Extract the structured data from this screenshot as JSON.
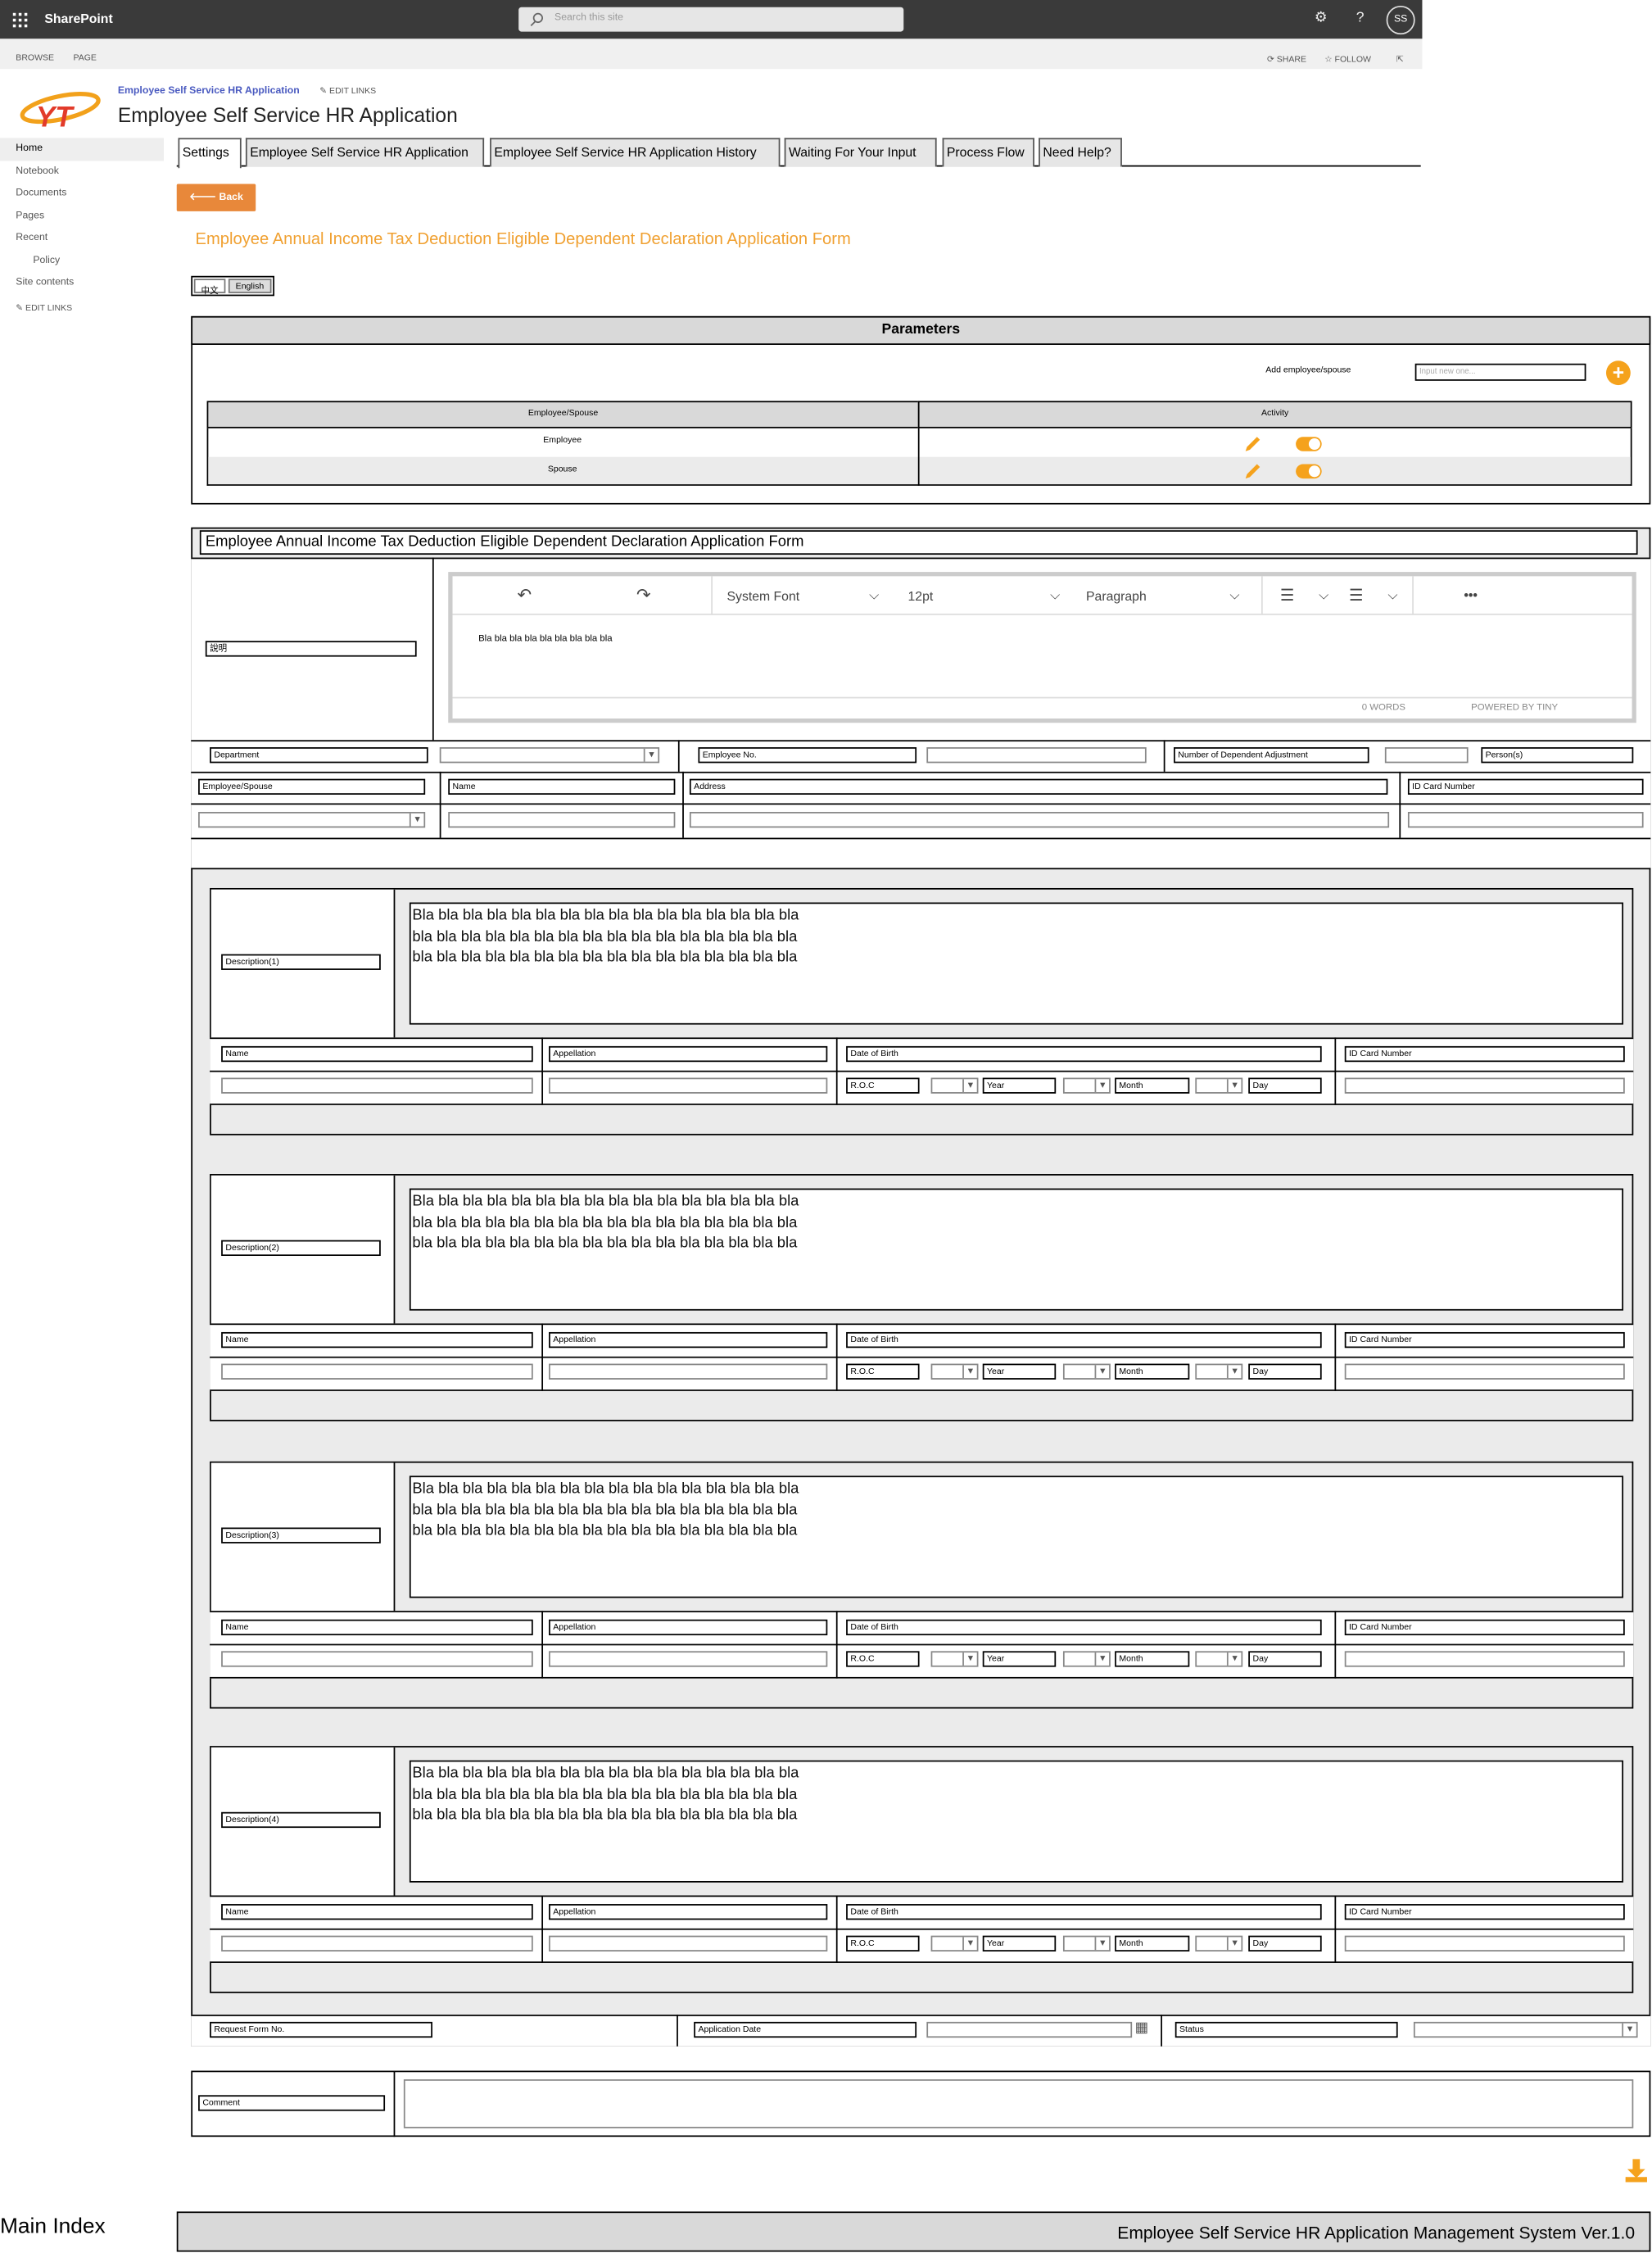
{
  "topbar": {
    "app_name": "SharePoint",
    "search_placeholder": "Search this site",
    "settings_icon": "gear-icon",
    "help_label": "?",
    "avatar_initials": "SS"
  },
  "ribbon": {
    "browse": "BROWSE",
    "page": "PAGE",
    "share": "SHARE",
    "follow": "FOLLOW"
  },
  "site": {
    "link": "Employee Self Service HR Application",
    "edit_links": "EDIT LINKS",
    "title": "Employee Self Service HR Application"
  },
  "leftnav": {
    "items": [
      "Home",
      "Notebook",
      "Documents",
      "Pages",
      "Recent",
      "Policy",
      "Site contents"
    ],
    "edit_links": "EDIT LINKS"
  },
  "tabs": [
    "Settings",
    "Employee Self Service HR Application",
    "Employee Self Service HR Application History",
    "Waiting For Your Input",
    "Process Flow",
    "Need Help?"
  ],
  "back_label": "Back",
  "form_title": "Employee Annual Income Tax Deduction Eligible Dependent Declaration Application Form",
  "languages": [
    "中文",
    "English"
  ],
  "parameters": {
    "title": "Parameters",
    "add_label": "Add employee/spouse",
    "add_placeholder": "Input new one...",
    "add_button": "+",
    "col_employee_spouse": "Employee/Spouse",
    "col_activity": "Activity",
    "rows": [
      "Employee",
      "Spouse"
    ]
  },
  "form": {
    "header": "Employee Annual Income Tax Deduction Eligible Dependent Declaration Application Form",
    "explain_label": "說明",
    "editor": {
      "font": "System Font",
      "size": "12pt",
      "block": "Paragraph",
      "more": "•••",
      "content": "Bla bla bla bla bla bla bla bla bla",
      "words": "0 WORDS",
      "powered": "POWERED BY TINY"
    },
    "department": "Department",
    "employee_no": "Employee No.",
    "dependent_adjust": "Number of Dependent Adjustment",
    "persons": "Person(s)",
    "employee_spouse": "Employee/Spouse",
    "name": "Name",
    "address": "Address",
    "id_card": "ID Card Number"
  },
  "dependents": [
    {
      "desc": "Description(1)",
      "text": "Bla bla bla bla bla bla bla bla bla bla bla bla bla bla bla bla\nbla bla bla bla bla bla bla bla bla bla bla bla bla bla bla bla\nbla bla bla bla bla bla bla bla bla bla bla bla bla bla bla bla"
    },
    {
      "desc": "Description(2)",
      "text": "Bla bla bla bla bla bla bla bla bla bla bla bla bla bla bla bla\nbla bla bla bla bla bla bla bla bla bla bla bla bla bla bla bla\nbla bla bla bla bla bla bla bla bla bla bla bla bla bla bla bla"
    },
    {
      "desc": "Description(3)",
      "text": "Bla bla bla bla bla bla bla bla bla bla bla bla bla bla bla bla\nbla bla bla bla bla bla bla bla bla bla bla bla bla bla bla bla\nbla bla bla bla bla bla bla bla bla bla bla bla bla bla bla bla"
    },
    {
      "desc": "Description(4)",
      "text": "Bla bla bla bla bla bla bla bla bla bla bla bla bla bla bla bla\nbla bla bla bla bla bla bla bla bla bla bla bla bla bla bla bla\nbla bla bla bla bla bla bla bla bla bla bla bla bla bla bla bla"
    }
  ],
  "dependent_labels": {
    "name": "Name",
    "appellation": "Appellation",
    "dob": "Date of Birth",
    "id_card": "ID Card Number",
    "roc": "R.O.C",
    "year": "Year",
    "month": "Month",
    "day": "Day"
  },
  "bottom": {
    "request_no": "Request Form No.",
    "app_date": "Application Date",
    "status": "Status",
    "comment": "Comment"
  },
  "footer": {
    "main_index": "Main Index",
    "system": "Employee Self Service HR Application Management System Ver.1.0"
  },
  "colors": {
    "accent": "#f5a21c",
    "back": "#e8883a",
    "title": "#f0a030",
    "link": "#4a5ac0",
    "topbar": "#3a3a3a"
  }
}
